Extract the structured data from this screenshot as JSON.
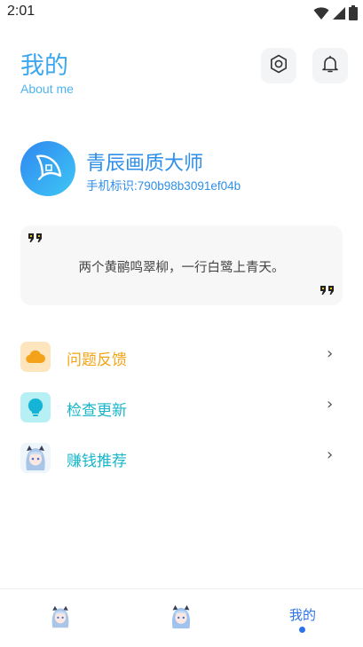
{
  "status_bar": {
    "time": "2:01"
  },
  "header": {
    "title": "我的",
    "subtitle": "About me"
  },
  "profile": {
    "name": "青辰画质大师",
    "device_id": "手机标识:790b98b3091ef04b"
  },
  "quote": {
    "text": "两个黄鹂鸣翠柳，一行白鹭上青天。"
  },
  "menu": [
    {
      "label": "问题反馈",
      "color": "#f2a417",
      "icon": "cloud-icon"
    },
    {
      "label": "检查更新",
      "color": "#18b6c9",
      "icon": "bulb-icon"
    },
    {
      "label": "赚钱推荐",
      "color": "#18b6c9",
      "icon": "anime-girl-icon"
    }
  ],
  "nav": {
    "items": [
      {
        "label": ""
      },
      {
        "label": ""
      },
      {
        "label": "我的"
      }
    ]
  },
  "colors": {
    "accent": "#3aa7ee",
    "nav_active": "#2b73e6"
  }
}
